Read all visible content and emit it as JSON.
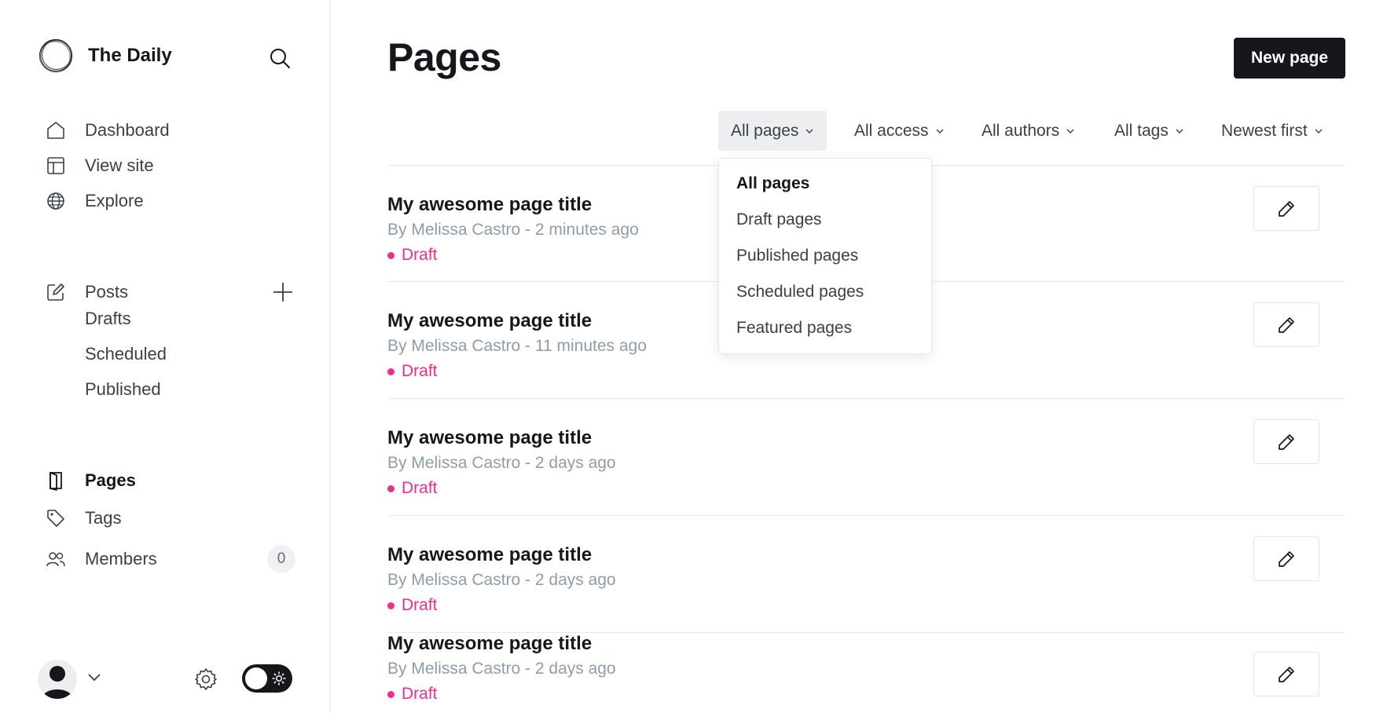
{
  "sidebar": {
    "brand_name": "The Daily",
    "nav": {
      "dashboard": "Dashboard",
      "view_site": "View site",
      "explore": "Explore",
      "posts": "Posts",
      "drafts": "Drafts",
      "scheduled": "Scheduled",
      "published": "Published",
      "pages": "Pages",
      "tags": "Tags",
      "members": "Members"
    },
    "members_count": "0"
  },
  "main": {
    "title": "Pages",
    "new_page_label": "New page",
    "filters": {
      "type": "All pages",
      "access": "All access",
      "authors": "All authors",
      "tags": "All tags",
      "sort": "Newest first"
    },
    "dropdown": {
      "options": [
        "All pages",
        "Draft pages",
        "Published pages",
        "Scheduled pages",
        "Featured pages"
      ],
      "selected": "All pages"
    },
    "pages": [
      {
        "title": "My awesome page title",
        "meta": "By Melissa Castro - 2 minutes ago",
        "status": "Draft"
      },
      {
        "title": "My awesome page title",
        "meta": "By Melissa Castro - 11 minutes ago",
        "status": "Draft"
      },
      {
        "title": "My awesome page title",
        "meta": "By Melissa Castro - 2 days ago",
        "status": "Draft"
      },
      {
        "title": "My awesome page title",
        "meta": "By Melissa Castro - 2 days ago",
        "status": "Draft"
      },
      {
        "title": "My awesome page title",
        "meta": "By Melissa Castro - 2 days ago",
        "status": "Draft"
      }
    ]
  },
  "colors": {
    "accent_dark": "#15171a",
    "draft_pink": "#f02d8a",
    "muted_text": "#8e9cac",
    "border": "#e6e8eb"
  },
  "icons": {
    "brand": "logo-ring-icon",
    "search": "search-icon",
    "dashboard": "home-icon",
    "view_site": "layout-icon",
    "explore": "globe-icon",
    "posts": "edit-icon",
    "add": "plus-icon",
    "pages": "page-icon",
    "tags": "tag-icon",
    "members": "members-icon",
    "settings": "gear-icon",
    "theme": "sun-icon",
    "edit_row": "pencil-icon"
  }
}
